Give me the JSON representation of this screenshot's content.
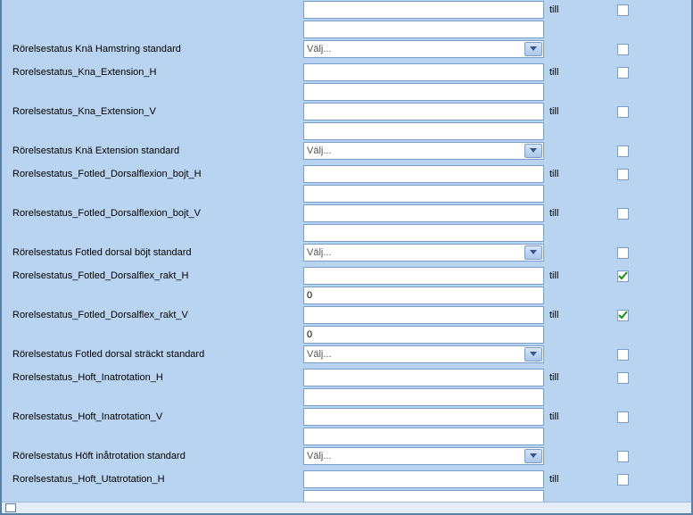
{
  "common": {
    "till": "till",
    "select_placeholder": "Välj..."
  },
  "rows": [
    {
      "id": "partial-top",
      "type": "range",
      "label": "",
      "from": "",
      "to": "",
      "checked": false
    },
    {
      "id": "kna-hamstring-std",
      "type": "select",
      "label": "Rörelsestatus Knä Hamstring standard",
      "value": "Välj...",
      "checked": false
    },
    {
      "id": "kna-extension-h",
      "type": "range",
      "label": "Rorelsestatus_Kna_Extension_H",
      "from": "",
      "to": "",
      "checked": false
    },
    {
      "id": "kna-extension-v",
      "type": "range",
      "label": "Rorelsestatus_Kna_Extension_V",
      "from": "",
      "to": "",
      "checked": false
    },
    {
      "id": "kna-extension-std",
      "type": "select",
      "label": "Rörelsestatus Knä Extension standard",
      "value": "Välj...",
      "checked": false
    },
    {
      "id": "fotled-dorsalflexion-bojt-h",
      "type": "range",
      "label": "Rorelsestatus_Fotled_Dorsalflexion_bojt_H",
      "from": "",
      "to": "",
      "checked": false
    },
    {
      "id": "fotled-dorsalflexion-bojt-v",
      "type": "range",
      "label": "Rorelsestatus_Fotled_Dorsalflexion_bojt_V",
      "from": "",
      "to": "",
      "checked": false
    },
    {
      "id": "fotled-dorsal-bojt-std",
      "type": "select",
      "label": "Rörelsestatus Fotled dorsal böjt standard",
      "value": "Välj...",
      "checked": false
    },
    {
      "id": "fotled-dorsalflex-rakt-h",
      "type": "range",
      "label": "Rorelsestatus_Fotled_Dorsalflex_rakt_H",
      "from": "",
      "to": "0",
      "checked": true
    },
    {
      "id": "fotled-dorsalflex-rakt-v",
      "type": "range",
      "label": "Rorelsestatus_Fotled_Dorsalflex_rakt_V",
      "from": "",
      "to": "0",
      "checked": true
    },
    {
      "id": "fotled-dorsal-strackt-std",
      "type": "select",
      "label": "Rörelsestatus Fotled dorsal sträckt standard",
      "value": "Välj...",
      "checked": false
    },
    {
      "id": "hoft-inatrotation-h",
      "type": "range",
      "label": "Rorelsestatus_Hoft_Inatrotation_H",
      "from": "",
      "to": "",
      "checked": false
    },
    {
      "id": "hoft-inatrotation-v",
      "type": "range",
      "label": "Rorelsestatus_Hoft_Inatrotation_V",
      "from": "",
      "to": "",
      "checked": false
    },
    {
      "id": "hoft-inatrotation-std",
      "type": "select",
      "label": "Rörelsestatus Höft inåtrotation standard",
      "value": "Välj...",
      "checked": false
    },
    {
      "id": "hoft-utatrotation-h",
      "type": "range",
      "label": "Rorelsestatus_Hoft_Utatrotation_H",
      "from": "",
      "to": "",
      "checked": false
    }
  ]
}
